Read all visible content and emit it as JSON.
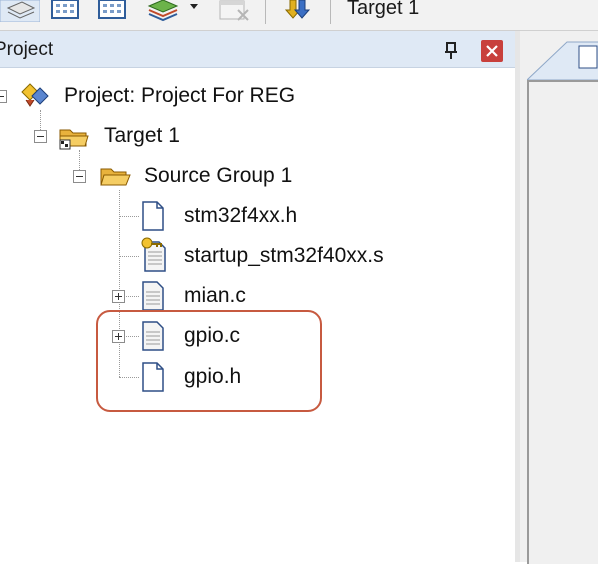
{
  "toolbar": {
    "target_select_value": "Target 1",
    "buttons": [
      "stack-icon",
      "batch-build-icon",
      "rebuild-icon",
      "layers-icon",
      "dropdown-arrow-icon",
      "disabled-window-icon",
      "download-icon"
    ]
  },
  "panel": {
    "title": "Project",
    "pin_icon": "pin-icon",
    "close_icon": "close-icon",
    "close_color": "#c8403c"
  },
  "tree": {
    "root": {
      "label": "Project: Project For REG",
      "icon": "project-icon"
    },
    "target": {
      "label": "Target 1",
      "icon": "target-folder-icon"
    },
    "group": {
      "label": "Source Group 1",
      "icon": "folder-open-icon"
    },
    "files": [
      {
        "label": "stm32f4xx.h",
        "icon": "header-file-icon"
      },
      {
        "label": "startup_stm32f40xx.s",
        "icon": "asm-file-key-icon"
      },
      {
        "label": "mian.c",
        "icon": "c-file-icon"
      },
      {
        "label": "gpio.c",
        "icon": "c-file-icon"
      },
      {
        "label": "gpio.h",
        "icon": "header-file-icon"
      }
    ]
  },
  "annotation": {
    "color": "#c75a40"
  }
}
